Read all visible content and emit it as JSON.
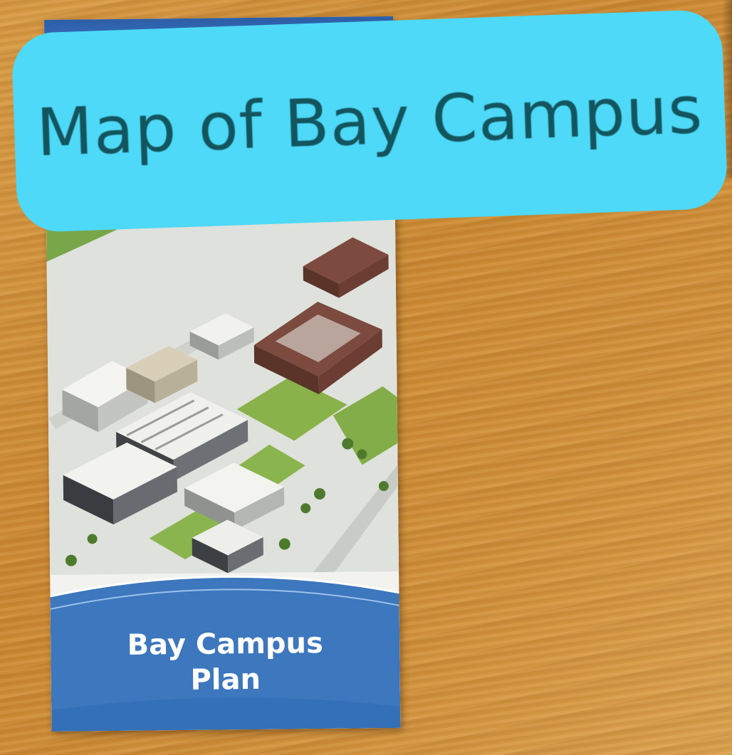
{
  "overlay": {
    "caption": "Map of Bay Campus"
  },
  "brochure": {
    "title_line1": "Bay Campus",
    "title_line2": "Plan"
  },
  "colors": {
    "overlay_background": "#4dd9f7",
    "overlay_text": "#13555e",
    "brochure_blue": "#3d77bd",
    "table_wood": "#c98731"
  }
}
